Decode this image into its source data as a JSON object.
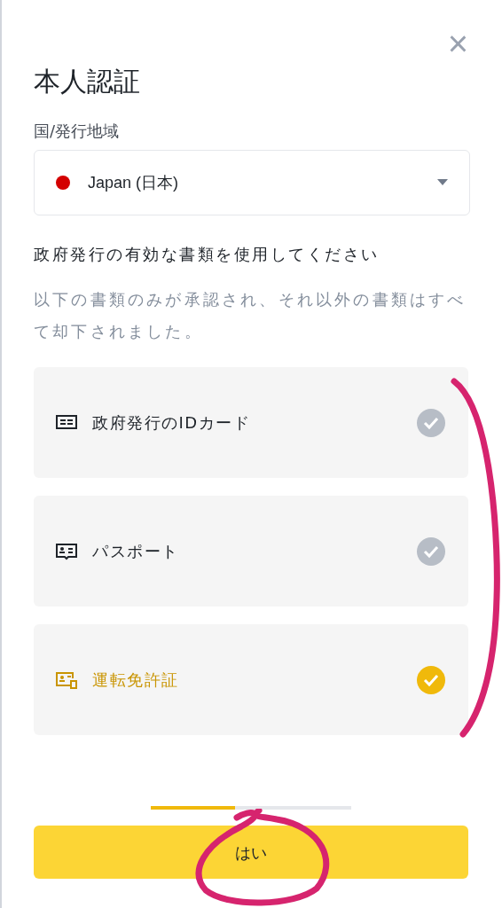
{
  "close": {
    "label": "×"
  },
  "title": "本人認証",
  "country": {
    "label": "国/発行地域",
    "value": "Japan (日本)",
    "color": "#d40000"
  },
  "heading": "政府発行の有効な書類を使用してください",
  "description": "以下の書類のみが承認され、それ以外の書類はすべて却下されました。",
  "documents": [
    {
      "kind": "id_card",
      "label": "政府発行のIDカード",
      "selected": false
    },
    {
      "kind": "passport",
      "label": "パスポート",
      "selected": false
    },
    {
      "kind": "license",
      "label": "運転免許証",
      "selected": true
    }
  ],
  "progress": {
    "level": 0.42
  },
  "confirm_button": "はい"
}
